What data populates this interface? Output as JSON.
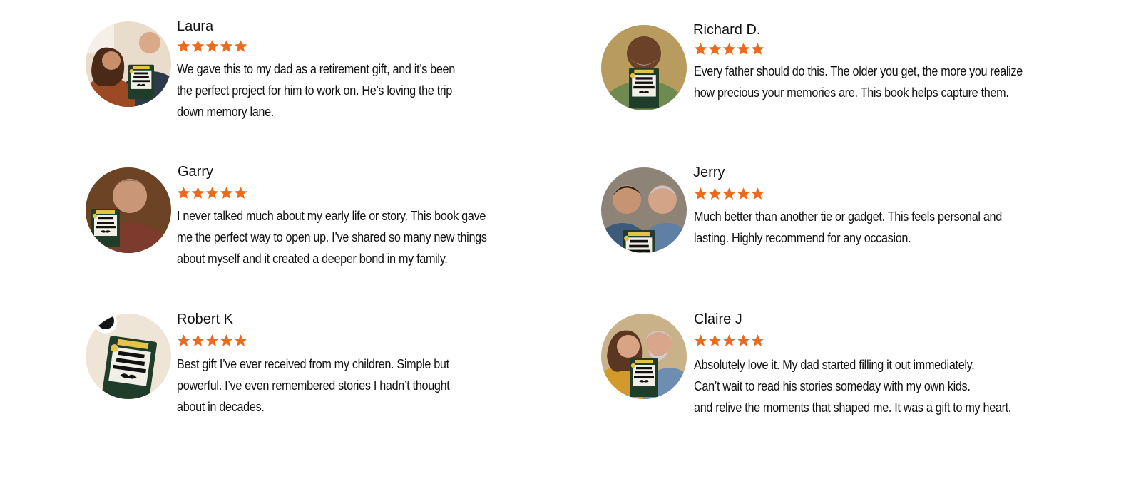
{
  "colors": {
    "star": "#ee6a1b",
    "text": "#111111",
    "background": "#ffffff",
    "book_green": "#1f3d28",
    "book_label": "#f1efe6",
    "book_ribbon": "#e3c34a"
  },
  "book_cover": {
    "edition": "2025 EDITION",
    "title_line1": "DAD,",
    "title_line2": "I'VE GOT",
    "title_line3": "QUESTIONS"
  },
  "reviews": [
    {
      "name": "Laura",
      "rating": 5,
      "avatar_icon": "woman-and-father-with-book-photo",
      "lines": [
        "We gave this to my dad as a retirement gift, and it’s been",
        "the perfect project for him to work on. He’s loving the trip",
        "down memory lane."
      ]
    },
    {
      "name": "Richard D.",
      "rating": 5,
      "avatar_icon": "smiling-man-holding-book-photo",
      "lines": [
        "Every father should do this. The older you get, the more you realize",
        "how precious your memories are. This book helps capture them."
      ]
    },
    {
      "name": "Garry",
      "rating": 5,
      "avatar_icon": "older-man-holding-book-photo",
      "lines": [
        "I never talked much about my early life or story. This book gave",
        "me the perfect way to open up. I’ve shared so many new things",
        "about myself and it created a deeper bond in my family."
      ]
    },
    {
      "name": "Jerry",
      "rating": 5,
      "avatar_icon": "son-and-father-with-book-photo",
      "lines": [
        "Much better than another tie or gadget. This feels personal and",
        "lasting. Highly recommend for any occasion."
      ]
    },
    {
      "name": "Robert K",
      "rating": 5,
      "avatar_icon": "book-with-coffee-cup-photo",
      "lines": [
        "Best gift I’ve ever received from my children. Simple but",
        "powerful. I’ve even remembered stories I hadn’t thought",
        "about in decades."
      ]
    },
    {
      "name": "Claire J",
      "rating": 5,
      "avatar_icon": "daughter-and-father-with-book-photo",
      "lines": [
        "Absolutely love it. My dad started filling it out immediately.",
        "Can’t wait to read his stories someday with my own kids.",
        "and relive the moments that shaped me. It was a gift to my heart."
      ]
    }
  ]
}
